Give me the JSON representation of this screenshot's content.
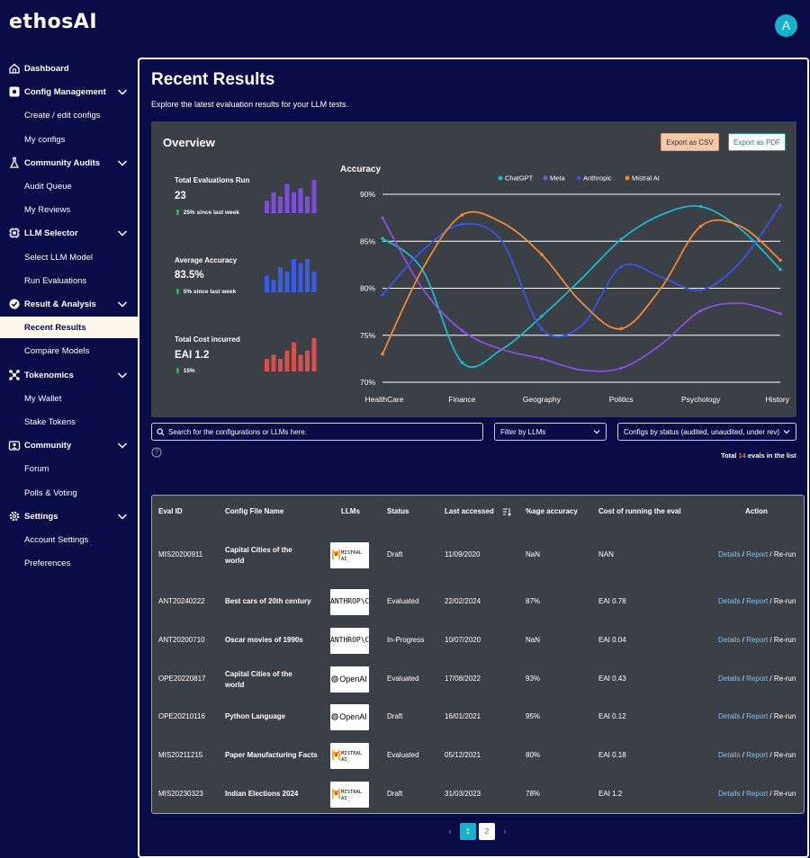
{
  "app": {
    "logo": "ethosAI",
    "avatar_initial": "A"
  },
  "sidebar": {
    "items": [
      {
        "label": "Dashboard",
        "type": "section-plain",
        "icon": "home-icon"
      },
      {
        "label": "Config Management",
        "type": "section",
        "icon": "gear-box-icon"
      },
      {
        "label": "Create / edit configs",
        "type": "sub"
      },
      {
        "label": "My configs",
        "type": "sub"
      },
      {
        "label": "Community Audits",
        "type": "section",
        "icon": "flask-icon"
      },
      {
        "label": "Audit Queue",
        "type": "sub"
      },
      {
        "label": "My Reviews",
        "type": "sub"
      },
      {
        "label": "LLM Selector",
        "type": "section",
        "icon": "chip-icon"
      },
      {
        "label": "Select LLM Model",
        "type": "sub"
      },
      {
        "label": "Run Evaluations",
        "type": "sub"
      },
      {
        "label": "Result & Analysis",
        "type": "section",
        "icon": "analysis-icon"
      },
      {
        "label": "Recent Results",
        "type": "sub",
        "active": true
      },
      {
        "label": "Compare Models",
        "type": "sub"
      },
      {
        "label": "Tokenomics",
        "type": "section",
        "icon": "network-icon"
      },
      {
        "label": "My Wallet",
        "type": "sub"
      },
      {
        "label": "Stake Tokens",
        "type": "sub"
      },
      {
        "label": "Community",
        "type": "section",
        "icon": "community-icon"
      },
      {
        "label": "Forum",
        "type": "sub"
      },
      {
        "label": "Polls & Voting",
        "type": "sub"
      },
      {
        "label": "Settings",
        "type": "section",
        "icon": "settings-icon"
      },
      {
        "label": "Account Settings",
        "type": "sub"
      },
      {
        "label": "Preferences",
        "type": "sub"
      }
    ]
  },
  "page": {
    "title": "Recent Results",
    "subtitle": "Explore the latest evaluation results for your LLM tests."
  },
  "overview": {
    "title": "Overview",
    "export_csv": "Export as CSV",
    "export_pdf": "Export as PDF",
    "stats": [
      {
        "label": "Total Evaluations Run",
        "value": "23",
        "change": "25% since last week",
        "color": "#7b4fd8",
        "bars": [
          3,
          5,
          4,
          7,
          5,
          6,
          4,
          8
        ]
      },
      {
        "label": "Average Accuracy",
        "value": "83.5%",
        "change": "5% since last week",
        "color": "#3a5be0",
        "bars": [
          4,
          3,
          6,
          5,
          8,
          7,
          8,
          5
        ]
      },
      {
        "label": "Total Cost incurred",
        "value": "EAI 1.2",
        "change": "15%",
        "color": "#d65050",
        "bars": [
          3,
          4,
          3,
          5,
          7,
          4,
          5,
          8
        ]
      }
    ]
  },
  "chart_data": {
    "type": "line",
    "title": "Accuracy",
    "categories": [
      "HealthCare",
      "Finance",
      "Geography",
      "Politics",
      "Psychology",
      "History"
    ],
    "ylim": [
      70,
      90
    ],
    "yticks": [
      "90%",
      "85%",
      "80%",
      "75%",
      "70%"
    ],
    "legend_position": "top",
    "series": [
      {
        "name": "ChatGPT",
        "color": "#1fb6c9",
        "x": [
          0,
          0.5,
          1,
          1.5,
          2,
          2.5,
          3,
          3.5,
          4,
          4.5,
          5
        ],
        "values": [
          85.3,
          82,
          72.1,
          73.5,
          77,
          81,
          85.2,
          87.8,
          88.7,
          86.3,
          82
        ]
      },
      {
        "name": "Meta",
        "color": "#8b4fe0",
        "x": [
          0,
          0.5,
          1,
          1.5,
          2,
          2.5,
          3,
          3.5,
          4,
          4.5,
          5
        ],
        "values": [
          87.5,
          80,
          75.5,
          73.5,
          72.5,
          71.3,
          71.5,
          74,
          77.6,
          78.4,
          77.3
        ]
      },
      {
        "name": "Anthropic",
        "color": "#3a55e0",
        "x": [
          0,
          0.5,
          1,
          1.5,
          2,
          2.5,
          3,
          3.5,
          4,
          4.5,
          5
        ],
        "values": [
          79.3,
          84,
          86.8,
          85,
          75.7,
          76,
          82.3,
          81.2,
          79.8,
          82.8,
          88.8
        ]
      },
      {
        "name": "Mistral AI",
        "color": "#f08a3a",
        "x": [
          0,
          0.5,
          1,
          1.5,
          2,
          2.5,
          3,
          3.5,
          4,
          4.5,
          5
        ],
        "values": [
          73,
          82,
          87.8,
          87,
          83.6,
          78.5,
          75.7,
          80,
          86.6,
          86.6,
          83
        ]
      }
    ]
  },
  "filters": {
    "search_placeholder": "Search for the configurations or LLMs here.",
    "llm_filter": "Filter by LLMs",
    "status_filter": "Configs by status (audited, unaudited, under rev)",
    "total_prefix": "Total",
    "total_count": "14",
    "total_suffix": "evals in the list"
  },
  "table": {
    "headers": [
      "Eval ID",
      "Config File Name",
      "LLMs",
      "Status",
      "Last accessed",
      "%age accuracy",
      "Cost of running the eval",
      "Action"
    ],
    "rows": [
      {
        "id": "MIS20200911",
        "config": "Capital Cities of the world",
        "llm": "MISTRAL AI_",
        "llm_kind": "mistral",
        "status": "Draft",
        "date": "11/09/2020",
        "accuracy": "NaN",
        "cost": "NAN"
      },
      {
        "id": "ANT20240222",
        "config": "Best cars of 20th century",
        "llm": "ANTHROP\\C",
        "llm_kind": "anthropic",
        "status": "Evaluated",
        "date": "22/02/2024",
        "accuracy": "87%",
        "cost": "EAI 0.78"
      },
      {
        "id": "ANT20200710",
        "config": "Oscar movies of 1990s",
        "llm": "ANTHROP\\C",
        "llm_kind": "anthropic",
        "status": "In-Progress",
        "date": "10/07/2020",
        "accuracy": "NaN",
        "cost": "EAI 0.04"
      },
      {
        "id": "OPE20220817",
        "config": "Capital Cities of the world",
        "llm": "OpenAI",
        "llm_kind": "openai",
        "status": "Evaluated",
        "date": "17/08/2022",
        "accuracy": "93%",
        "cost": "EAI 0.43"
      },
      {
        "id": "OPE20210116",
        "config": "Python Language",
        "llm": "OpenAI",
        "llm_kind": "openai",
        "status": "Draft",
        "date": "16/01/2021",
        "accuracy": "95%",
        "cost": "EAI 0.12"
      },
      {
        "id": "MIS20211215",
        "config": "Paper Manufacturing Facts",
        "llm": "MISTRAL AI_",
        "llm_kind": "mistral",
        "status": "Evaluated",
        "date": "05/12/2021",
        "accuracy": "80%",
        "cost": "EAI 0.18"
      },
      {
        "id": "MIS20230323",
        "config": "Indian Elections 2024",
        "llm": "MISTRAL AI_",
        "llm_kind": "mistral",
        "status": "Draft",
        "date": "31/03/2023",
        "accuracy": "78%",
        "cost": "EAI 1.2"
      }
    ],
    "action_details": "Details",
    "action_report": "Report",
    "action_rerun": "Re-run",
    "action_sep": "/"
  },
  "pagination": {
    "prev": "‹",
    "pages": [
      "1",
      "2"
    ],
    "current": "1",
    "next": "›"
  }
}
